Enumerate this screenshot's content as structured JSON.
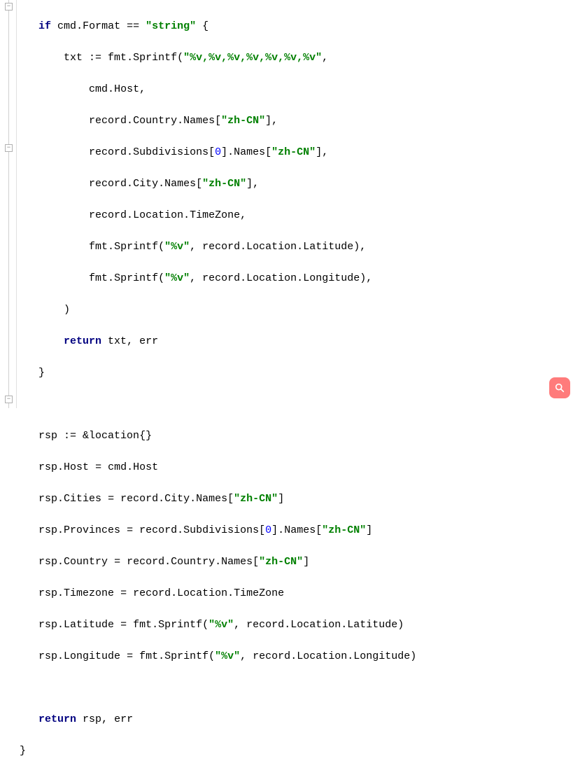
{
  "code": {
    "keywords": {
      "if": "if",
      "return": "return"
    },
    "strings": {
      "string_lit": "\"string\"",
      "fmt_multi": "\"%v,%v,%v,%v,%v,%v,%v\"",
      "zhcn": "\"zh-CN\"",
      "fmt_v": "\"%v\""
    },
    "idents": {
      "cmd": "cmd",
      "Format": "Format",
      "txt": "txt",
      "fmt": "fmt",
      "Sprintf": "Sprintf",
      "Host": "Host",
      "record": "record",
      "Country": "Country",
      "Names": "Names",
      "Subdivisions": "Subdivisions",
      "City": "City",
      "Location": "Location",
      "TimeZone": "TimeZone",
      "Latitude": "Latitude",
      "Longitude": "Longitude",
      "err": "err",
      "rsp": "rsp",
      "location": "location",
      "Cities": "Cities",
      "Provinces": "Provinces",
      "Timezone": "Timezone"
    },
    "nums": {
      "zero": "0"
    }
  }
}
